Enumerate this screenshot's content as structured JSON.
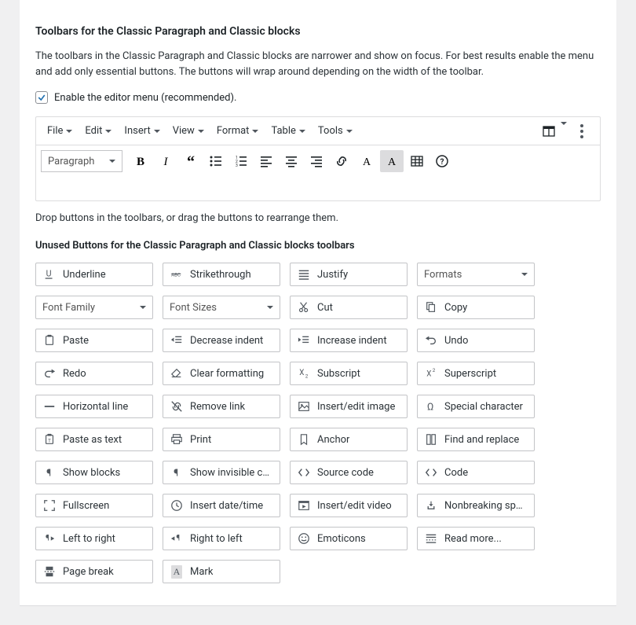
{
  "section": {
    "title": "Toolbars for the Classic Paragraph and Classic blocks",
    "description": "The toolbars in the Classic Paragraph and Classic blocks are narrower and show on focus. For best results enable the menu and add only essential buttons. The buttons will wrap around depending on the width of the toolbar.",
    "enable_menu_label": "Enable the editor menu (recommended).",
    "enable_menu_checked": true,
    "drop_note": "Drop buttons in the toolbars, or drag the buttons to rearrange them."
  },
  "menus": {
    "file": "File",
    "edit": "Edit",
    "insert": "Insert",
    "view": "View",
    "format": "Format",
    "table": "Table",
    "tools": "Tools"
  },
  "toolbar": {
    "format_select": "Paragraph"
  },
  "unused_heading": "Unused Buttons for the Classic Paragraph and Classic blocks toolbars",
  "unused": [
    {
      "key": "underline",
      "label": "Underline",
      "icon": "underline"
    },
    {
      "key": "strike",
      "label": "Strikethrough",
      "icon": "strike"
    },
    {
      "key": "justify",
      "label": "Justify",
      "icon": "align-justify"
    },
    {
      "key": "formats",
      "label": "Formats",
      "icon": "select"
    },
    {
      "key": "font-family",
      "label": "Font Family",
      "icon": "select"
    },
    {
      "key": "font-sizes",
      "label": "Font Sizes",
      "icon": "select"
    },
    {
      "key": "cut",
      "label": "Cut",
      "icon": "cut"
    },
    {
      "key": "copy",
      "label": "Copy",
      "icon": "copy"
    },
    {
      "key": "paste",
      "label": "Paste",
      "icon": "paste"
    },
    {
      "key": "outdent",
      "label": "Decrease indent",
      "icon": "outdent"
    },
    {
      "key": "indent",
      "label": "Increase indent",
      "icon": "indent"
    },
    {
      "key": "undo",
      "label": "Undo",
      "icon": "undo"
    },
    {
      "key": "redo",
      "label": "Redo",
      "icon": "redo"
    },
    {
      "key": "clear-fmt",
      "label": "Clear formatting",
      "icon": "eraser"
    },
    {
      "key": "subscript",
      "label": "Subscript",
      "icon": "sub"
    },
    {
      "key": "superscript",
      "label": "Superscript",
      "icon": "sup"
    },
    {
      "key": "hr",
      "label": "Horizontal line",
      "icon": "hr"
    },
    {
      "key": "unlink",
      "label": "Remove link",
      "icon": "unlink"
    },
    {
      "key": "image",
      "label": "Insert/edit image",
      "icon": "image"
    },
    {
      "key": "char",
      "label": "Special character",
      "icon": "omega"
    },
    {
      "key": "paste-text",
      "label": "Paste as text",
      "icon": "paste-text"
    },
    {
      "key": "print",
      "label": "Print",
      "icon": "print"
    },
    {
      "key": "anchor",
      "label": "Anchor",
      "icon": "bookmark"
    },
    {
      "key": "find",
      "label": "Find and replace",
      "icon": "find"
    },
    {
      "key": "show-blocks",
      "label": "Show blocks",
      "icon": "pilcrow"
    },
    {
      "key": "show-invis",
      "label": "Show invisible cha…",
      "icon": "pilcrow"
    },
    {
      "key": "source",
      "label": "Source code",
      "icon": "code"
    },
    {
      "key": "code",
      "label": "Code",
      "icon": "code"
    },
    {
      "key": "fullscreen",
      "label": "Fullscreen",
      "icon": "fullscreen"
    },
    {
      "key": "datetime",
      "label": "Insert date/time",
      "icon": "clock"
    },
    {
      "key": "video",
      "label": "Insert/edit video",
      "icon": "video"
    },
    {
      "key": "nbsp",
      "label": "Nonbreaking space",
      "icon": "nbsp"
    },
    {
      "key": "ltr",
      "label": "Left to right",
      "icon": "ltr"
    },
    {
      "key": "rtl",
      "label": "Right to left",
      "icon": "rtl"
    },
    {
      "key": "emoticons",
      "label": "Emoticons",
      "icon": "smile"
    },
    {
      "key": "readmore",
      "label": "Read more...",
      "icon": "readmore"
    },
    {
      "key": "pagebreak",
      "label": "Page break",
      "icon": "pagebreak"
    },
    {
      "key": "mark",
      "label": "Mark",
      "icon": "mark"
    }
  ]
}
